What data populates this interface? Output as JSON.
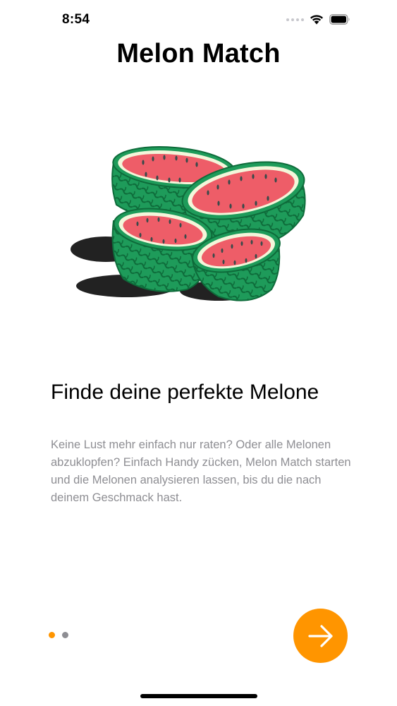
{
  "status_bar": {
    "time": "8:54",
    "icons": [
      "signal-icon",
      "wifi-icon",
      "battery-icon"
    ]
  },
  "app": {
    "title": "Melon Match"
  },
  "hero": {
    "image": "watermelon-halves-illustration"
  },
  "onboarding": {
    "headline": "Finde deine perfekte Melone",
    "description": "Keine Lust mehr einfach nur raten? Oder alle Melonen abzuklopfen? Einfach Handy zücken, Melon Match starten und die Melonen analysieren lassen, bis du die nach deinem Geschmack hast.",
    "page_count": 2,
    "current_page": 1
  },
  "next_button": {
    "icon": "arrow-right-icon"
  },
  "colors": {
    "accent": "#FF9500",
    "dot_inactive": "#8E8E93",
    "text_secondary": "#8E8E93",
    "melon_rind": "#1E9B5A",
    "melon_rind_dark": "#0E6B3A",
    "melon_flesh": "#EE5D68",
    "melon_pith": "#F3F6DA",
    "melon_seed": "#3A4A4A",
    "shadow": "#222222"
  }
}
